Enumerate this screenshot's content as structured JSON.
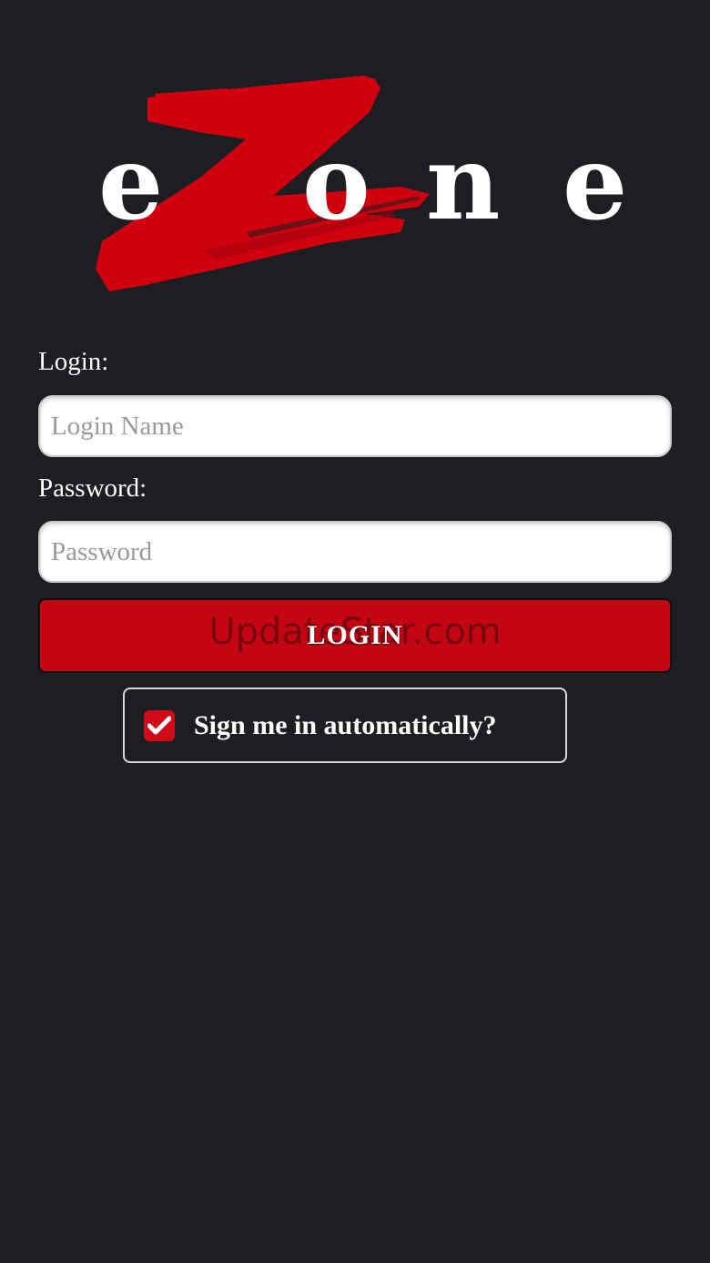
{
  "app": {
    "logo_text": "eZone",
    "logo_letters": [
      "e",
      "o",
      "n",
      "e"
    ],
    "brand_color": "#d0000f",
    "background_color": "#1c1e21"
  },
  "form": {
    "login_label": "Login:",
    "login_placeholder": "Login Name",
    "login_value": "",
    "password_label": "Password:",
    "password_placeholder": "Password",
    "password_value": "",
    "submit_label": "LOGIN",
    "auto_signin_label": "Sign me in automatically?",
    "auto_signin_checked": true,
    "checkbox_icon": "checkmark-icon"
  },
  "watermark": {
    "text": "UpdateStar.com"
  }
}
